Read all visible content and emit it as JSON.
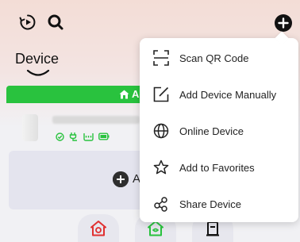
{
  "header": {
    "title": "Device",
    "icons": [
      "play-circle-icon",
      "search-icon",
      "add-circle-icon"
    ]
  },
  "room_bar": {
    "label": "A"
  },
  "device": {
    "status_icons": [
      "check-circle-icon",
      "plug-icon",
      "wifi-router-icon",
      "battery-icon"
    ]
  },
  "add_card": {
    "label": "A"
  },
  "bottom_tabs": [
    {
      "icon": "home-icon"
    },
    {
      "icon": "scene-home-icon"
    },
    {
      "icon": "device-icon"
    }
  ],
  "menu": {
    "items": [
      {
        "label": "Scan QR Code",
        "icon": "scan-qr-icon"
      },
      {
        "label": "Add Device Manually",
        "icon": "edit-square-icon"
      },
      {
        "label": "Online Device",
        "icon": "globe-icon"
      },
      {
        "label": "Add to Favorites",
        "icon": "star-icon"
      },
      {
        "label": "Share Device",
        "icon": "share-nodes-icon"
      }
    ]
  },
  "colors": {
    "accent_green": "#29c23e",
    "tab_red": "#e03030",
    "tab_green": "#29c23e"
  }
}
